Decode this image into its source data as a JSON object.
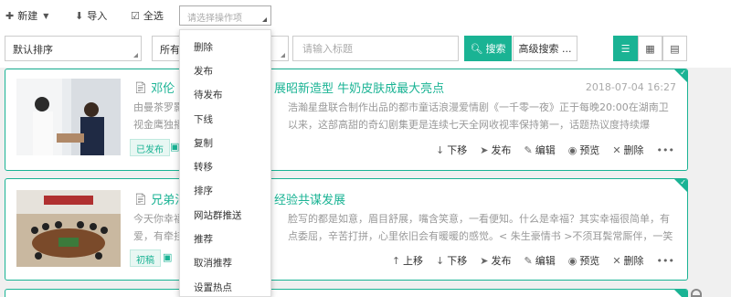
{
  "toolbar": {
    "new_label": "新建",
    "import_label": "导入",
    "select_all_label": "全选",
    "operation_placeholder": "请选择操作项"
  },
  "filters": {
    "sort_value": "默认排序",
    "status_value": "所有",
    "keyword_placeholder": "请输入标题",
    "search_label": "搜索",
    "advanced_label": "高级搜索 ..."
  },
  "operations": [
    "删除",
    "发布",
    "待发布",
    "下线",
    "复制",
    "转移",
    "排序",
    "网站群推送",
    "推荐",
    "取消推荐",
    "设置热点"
  ],
  "articles": [
    {
      "title_left": "邓伦《",
      "title_right": "展昭新造型 牛奶皮肤成最大亮点",
      "time": "2018-07-04 16:27",
      "summary_line1_left": "由曼茶罗影",
      "summary_line1_right": "浩瀚星盘联合制作出品的都市童话浪漫爱情剧《一千零一夜》正于每晚20:00在湖南卫",
      "summary_line2_left": "视金鹰独播",
      "summary_line2_right": "以来，这部高甜的奇幻剧集更是连续七天全网收视率保持第一，话题热议度持续爆",
      "status": "已发布",
      "actions": [
        "下移",
        "发布",
        "编辑",
        "预览",
        "删除"
      ]
    },
    {
      "title_left": "兄弟法",
      "title_right": "经验共谋发展",
      "time": "",
      "summary_line1_left": "今天你幸福",
      "summary_line1_right": "脸写的都是如意，眉目舒展，嘴含笑意，一看便知。什么是幸福？其实幸福很简单，有",
      "summary_line2_left": "爱，有牵挂",
      "summary_line2_right": "点委屈，辛苦打拼，心里依旧会有暖暖的感觉。< 朱生豪情书 >不须耳鬓常厮伴，一笑",
      "status": "初稿",
      "actions": [
        "上移",
        "下移",
        "发布",
        "编辑",
        "预览",
        "删除"
      ]
    }
  ],
  "colors": {
    "accent": "#1ab394"
  }
}
